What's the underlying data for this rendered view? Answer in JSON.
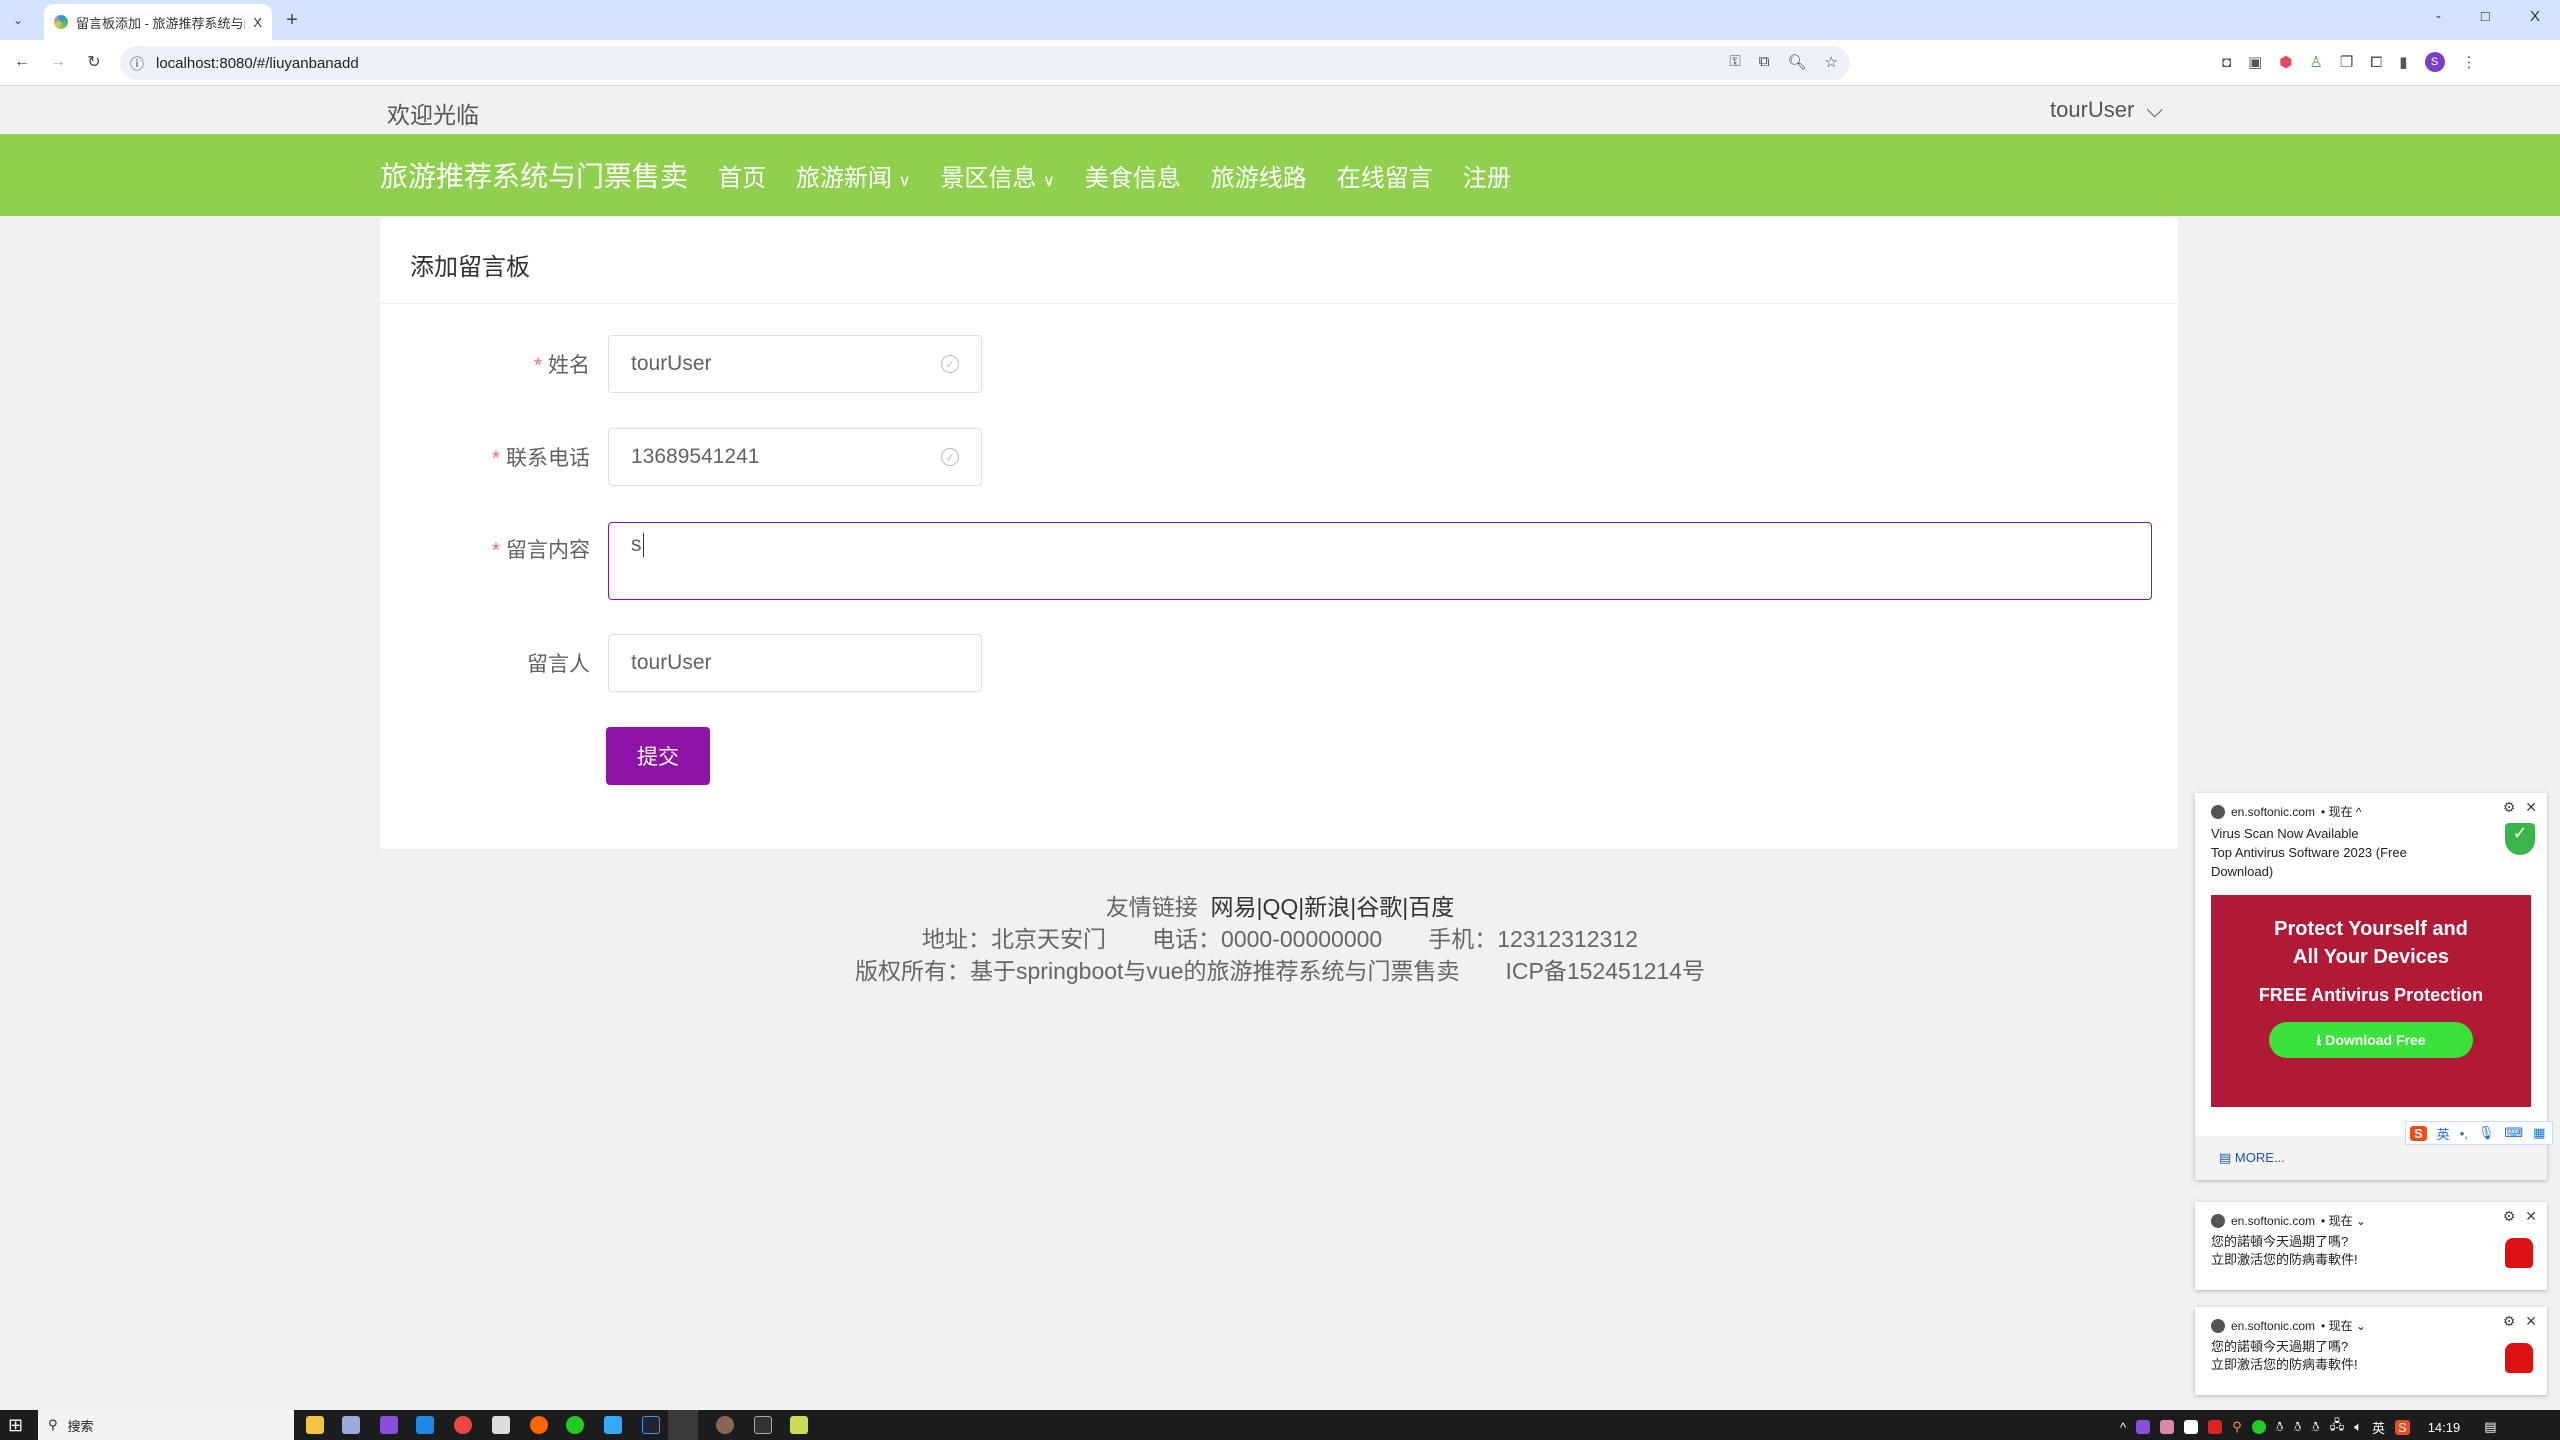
{
  "browser": {
    "tab_title": "留言板添加 - 旅游推荐系统与门",
    "url": "localhost:8080/#/liuyanbanadd",
    "new_tab": "+",
    "tab_close": "X",
    "window_controls": [
      "-",
      "□",
      "X"
    ],
    "profile_initial": "S"
  },
  "topbar": {
    "welcome": "欢迎光临",
    "user": "tourUser"
  },
  "nav": {
    "brand": "旅游推荐系统与门票售卖",
    "items": [
      {
        "label": "首页"
      },
      {
        "label": "旅游新闻",
        "dropdown": true
      },
      {
        "label": "景区信息",
        "dropdown": true
      },
      {
        "label": "美食信息"
      },
      {
        "label": "旅游线路"
      },
      {
        "label": "在线留言"
      },
      {
        "label": "注册"
      }
    ]
  },
  "form": {
    "title": "添加留言板",
    "fields": [
      {
        "label": "姓名",
        "required": true,
        "value": "tourUser",
        "validated": true
      },
      {
        "label": "联系电话",
        "required": true,
        "value": "13689541241",
        "validated": true
      },
      {
        "label": "留言内容",
        "required": true,
        "value": "s"
      },
      {
        "label": "留言人",
        "required": false,
        "value": "tourUser"
      }
    ],
    "submit": "提交",
    "submit_color": "#9013a8"
  },
  "footer": {
    "links_label": "友情链接",
    "links": [
      "网易",
      "QQ",
      "新浪",
      "谷歌",
      "百度"
    ],
    "separator": "|",
    "address": "地址：北京天安门",
    "phone": "电话：0000-00000000",
    "mobile": "手机：12312312312",
    "copyright": "版权所有：基于springboot与vue的旅游推荐系统与门票售卖",
    "icp": "ICP备152451214号"
  },
  "notifications": [
    {
      "source": "en.softonic.com",
      "time": "• 现在 ^",
      "title": "Virus Scan Now Available",
      "body": "Top Antivirus Software 2023 (Free Download)",
      "banner_line1": "Protect Yourself and",
      "banner_line2": "All Your Devices",
      "banner_line3": "FREE Antivirus Protection",
      "cta": "Download Free",
      "more": "MORE..."
    },
    {
      "source": "en.softonic.com",
      "time": "• 现在 ⌄",
      "line1": "您的諾頓今天過期了嗎?",
      "line2": "立即激活您的防病毒軟件!"
    },
    {
      "source": "en.softonic.com",
      "time": "• 现在 ⌄",
      "line1": "您的諾頓今天過期了嗎?",
      "line2": "立即激活您的防病毒軟件!"
    }
  ],
  "ime": {
    "mode": "英"
  },
  "taskbar": {
    "search": "搜索",
    "clock": "14:19",
    "ime": "英"
  },
  "colors": {
    "nav": "#8fd14f",
    "accent": "#9013a8"
  }
}
